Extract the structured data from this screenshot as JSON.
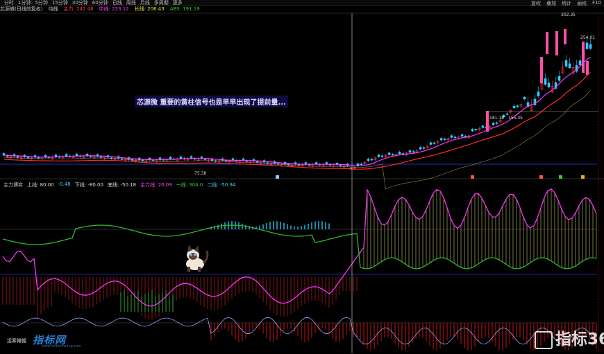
{
  "menubar": {
    "items": [
      "分时",
      "1分钟",
      "5分钟",
      "15分钟",
      "30分钟",
      "60分钟",
      "日线",
      "周线",
      "月线",
      "多周期",
      "更多"
    ],
    "right": [
      "复权",
      "叠加",
      "统计",
      "画线",
      "F10"
    ]
  },
  "infoline": {
    "title": "芯源微(日线前复权)",
    "ma_label": "均线",
    "values": [
      "主力: 242.48",
      "中线: 223.12",
      "长线: 206.43",
      "ABS: 191.19"
    ]
  },
  "annotation": "芯源微 重要的黄柱信号也是早早出现了提前量...",
  "price_labels": {
    "high": "302.35",
    "right1": "254.01",
    "mid": "181.18",
    "mid2": "155.35",
    "low": "75.38"
  },
  "indicator_legend": {
    "name": "主力博弈",
    "values": [
      "上线: 80.00",
      "-0.48",
      "下线: -80.00",
      "底线: -50.18"
    ],
    "line2": [
      "主力线: 20.09",
      "一线: 304.0",
      "二线: -50.94"
    ]
  },
  "corner_label": "运筹帷幄",
  "watermark1": "指标网",
  "watermark1_sub": "www.zhibiaowang.com",
  "watermark2": "指标365",
  "colors": {
    "up": "#ff3b3b",
    "down": "#32c8ff",
    "ma1": "#ff33ff",
    "ma2": "#ff2a2a",
    "green": "#2fb82f",
    "yellow": "#e8e87a",
    "cyan_bar": "#21b4d8"
  }
}
